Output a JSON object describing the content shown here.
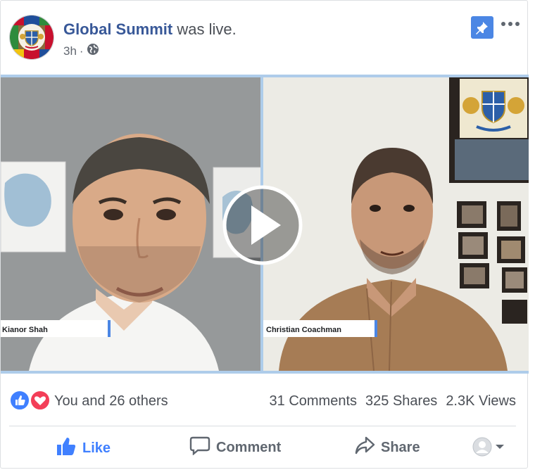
{
  "post": {
    "page_name": "Global Summit",
    "status_text": "was live.",
    "time": "3h",
    "privacy_icon": "globe-icon",
    "menu_icon": "more-options-icon",
    "pin_icon": "pin-icon"
  },
  "video": {
    "left_participant": "Kianor Shah",
    "right_participant": "Christian Coachman",
    "play_icon": "play-icon"
  },
  "engagement": {
    "reactions_text": "You and 26 others",
    "comments": "31 Comments",
    "shares": "325 Shares",
    "views": "2.3K Views"
  },
  "actions": {
    "like": "Like",
    "comment": "Comment",
    "share": "Share"
  },
  "colors": {
    "link": "#385898",
    "like_blue": "#4080ff",
    "pin_blue": "#4b86e4",
    "love_red": "#f33e58"
  }
}
